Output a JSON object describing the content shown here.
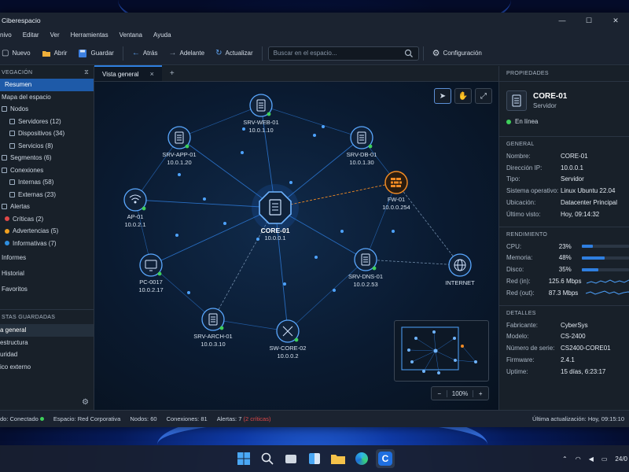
{
  "window": {
    "title": "Ciberespacio"
  },
  "menu": [
    "nivo",
    "Editar",
    "Ver",
    "Herramientas",
    "Ventana",
    "Ayuda"
  ],
  "toolbar": {
    "new": "Nuevo",
    "open": "Abrir",
    "save": "Guardar",
    "back": "Atrás",
    "forward": "Adelante",
    "refresh": "Actualizar",
    "search_placeholder": "Buscar en el espacio...",
    "settings": "Configuración"
  },
  "sidebar": {
    "header": "VEGACIÓN",
    "items": [
      {
        "label": "Resumen"
      },
      {
        "label": "Mapa del espacio"
      },
      {
        "label": "Nodos"
      },
      {
        "label": "Servidores (12)"
      },
      {
        "label": "Dispositivos (34)"
      },
      {
        "label": "Servicios (8)"
      },
      {
        "label": "Segmentos (6)"
      },
      {
        "label": "Conexiones"
      },
      {
        "label": "Internas (58)"
      },
      {
        "label": "Externas (23)"
      },
      {
        "label": "Alertas"
      },
      {
        "label": "Críticas (2)"
      },
      {
        "label": "Advertencias (5)"
      },
      {
        "label": "Informativas (7)"
      },
      {
        "label": "Informes"
      },
      {
        "label": "Historial"
      },
      {
        "label": "Favoritos"
      }
    ],
    "saved_header": "STAS GUARDADAS",
    "saved": [
      {
        "label": "a general"
      },
      {
        "label": "estructura"
      },
      {
        "label": "uridad"
      },
      {
        "label": "ico externo"
      }
    ]
  },
  "tabs": [
    {
      "label": "Vista general",
      "close": "×"
    }
  ],
  "tab_add": "+",
  "map": {
    "nodes": [
      {
        "id": "core",
        "name": "CORE-01",
        "ip": "10.0.0.1"
      },
      {
        "id": "web",
        "name": "SRV-WEB-01",
        "ip": "10.0.1.10"
      },
      {
        "id": "app",
        "name": "SRV-APP-01",
        "ip": "10.0.1.20"
      },
      {
        "id": "db",
        "name": "SRV-DB-01",
        "ip": "10.0.1.30"
      },
      {
        "id": "ap",
        "name": "AP-01",
        "ip": "10.0.2.1"
      },
      {
        "id": "fw",
        "name": "FW-01",
        "ip": "10.0.0.254"
      },
      {
        "id": "pc",
        "name": "PC-0017",
        "ip": "10.0.2.17"
      },
      {
        "id": "dns",
        "name": "SRV-DNS-01",
        "ip": "10.0.2.53"
      },
      {
        "id": "inet",
        "name": "INTERNET",
        "ip": ""
      },
      {
        "id": "arch",
        "name": "SRV-ARCH-01",
        "ip": "10.0.3.10"
      },
      {
        "id": "sw",
        "name": "SW-CORE-02",
        "ip": "10.0.0.2"
      }
    ],
    "zoom": "100%",
    "zoom_out": "−",
    "zoom_in": "+"
  },
  "properties": {
    "header": "PROPIEDADES",
    "name": "CORE-01",
    "type": "Servidor",
    "status": "En línea",
    "general_header": "GENERAL",
    "general": [
      {
        "k": "Nombre:",
        "v": "CORE-01"
      },
      {
        "k": "Dirección IP:",
        "v": "10.0.0.1"
      },
      {
        "k": "Tipo:",
        "v": "Servidor"
      },
      {
        "k": "Sistema operativo:",
        "v": "Linux Ubuntu 22.04"
      },
      {
        "k": "Ubicación:",
        "v": "Datacenter Principal"
      },
      {
        "k": "Último visto:",
        "v": "Hoy, 09:14:32"
      }
    ],
    "perf_header": "RENDIMIENTO",
    "perf": [
      {
        "k": "CPU:",
        "v": "23%",
        "level": 0.23
      },
      {
        "k": "Memoria:",
        "v": "48%",
        "level": 0.48
      },
      {
        "k": "Disco:",
        "v": "35%",
        "level": 0.35
      }
    ],
    "net": [
      {
        "k": "Red (in):",
        "v": "125.6 Mbps"
      },
      {
        "k": "Red (out):",
        "v": "87.3 Mbps"
      }
    ],
    "details_header": "DETALLES",
    "details": [
      {
        "k": "Fabricante:",
        "v": "CyberSys"
      },
      {
        "k": "Modelo:",
        "v": "CS-2400"
      },
      {
        "k": "Número de serie:",
        "v": "CS2400-CORE01"
      },
      {
        "k": "Firmware:",
        "v": "2.4.1"
      },
      {
        "k": "Uptime:",
        "v": "15 días, 6:23:17"
      }
    ]
  },
  "status": {
    "conn": "do: Conectado",
    "space": "Espacio: Red Corporativa",
    "nodes": "Nodos: 60",
    "connections": "Conexiones: 81",
    "alerts": "Alertas: 7",
    "critical": "(2 críticas)",
    "updated": "Última actualización: Hoy, 09:15:10"
  },
  "taskbar": {
    "date": "24/0"
  },
  "colors": {
    "accent": "#2f7fe0",
    "online": "#3ecf5a",
    "critical": "#e04848",
    "warning": "#f0a020",
    "info": "#2f8fe0",
    "firewall": "#f08a24"
  }
}
